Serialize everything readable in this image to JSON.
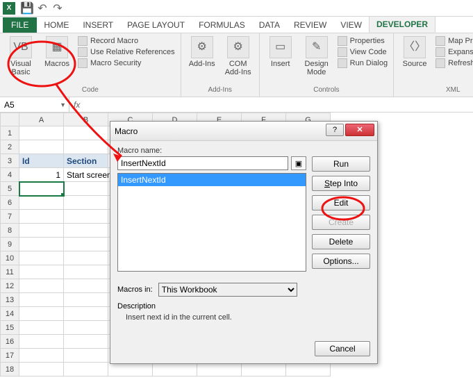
{
  "ribbon_tabs": {
    "file": "FILE",
    "home": "HOME",
    "insert": "INSERT",
    "page_layout": "PAGE LAYOUT",
    "formulas": "FORMULAS",
    "data": "DATA",
    "review": "REVIEW",
    "view": "VIEW",
    "developer": "DEVELOPER"
  },
  "ribbon": {
    "code": {
      "visual_basic": "Visual Basic",
      "macros": "Macros",
      "record_macro": "Record Macro",
      "use_relative": "Use Relative References",
      "macro_security": "Macro Security",
      "group": "Code"
    },
    "addins": {
      "addins": "Add-Ins",
      "com_addins": "COM Add-Ins",
      "group": "Add-Ins"
    },
    "controls": {
      "insert": "Insert",
      "design_mode": "Design Mode",
      "properties": "Properties",
      "view_code": "View Code",
      "run_dialog": "Run Dialog",
      "group": "Controls"
    },
    "xml": {
      "source": "Source",
      "map_properties": "Map Properties",
      "expansion_packs": "Expansion Packs",
      "refresh_data": "Refresh Data",
      "group": "XML"
    }
  },
  "namebox": "A5",
  "formula_fx": "fx",
  "columns": [
    "A",
    "B",
    "C",
    "D",
    "E",
    "F",
    "G"
  ],
  "rows": [
    1,
    2,
    3,
    4,
    5,
    6,
    7,
    8,
    9,
    10,
    11,
    12,
    13,
    14,
    15,
    16,
    17,
    18
  ],
  "data_headers": {
    "id": "Id",
    "section": "Section"
  },
  "data_row": {
    "id": "1",
    "section": "Start screen"
  },
  "dialog": {
    "title": "Macro",
    "name_label": "Macro name:",
    "name_value": "InsertNextId",
    "list": [
      "InsertNextId"
    ],
    "buttons": {
      "run": "Run",
      "step_into": "Step Into",
      "edit": "Edit",
      "create": "Create",
      "delete": "Delete",
      "options": "Options...",
      "cancel": "Cancel"
    },
    "macros_in_label": "Macros in:",
    "macros_in_value": "This Workbook",
    "description_label": "Description",
    "description_text": "Insert next id in the current cell."
  }
}
